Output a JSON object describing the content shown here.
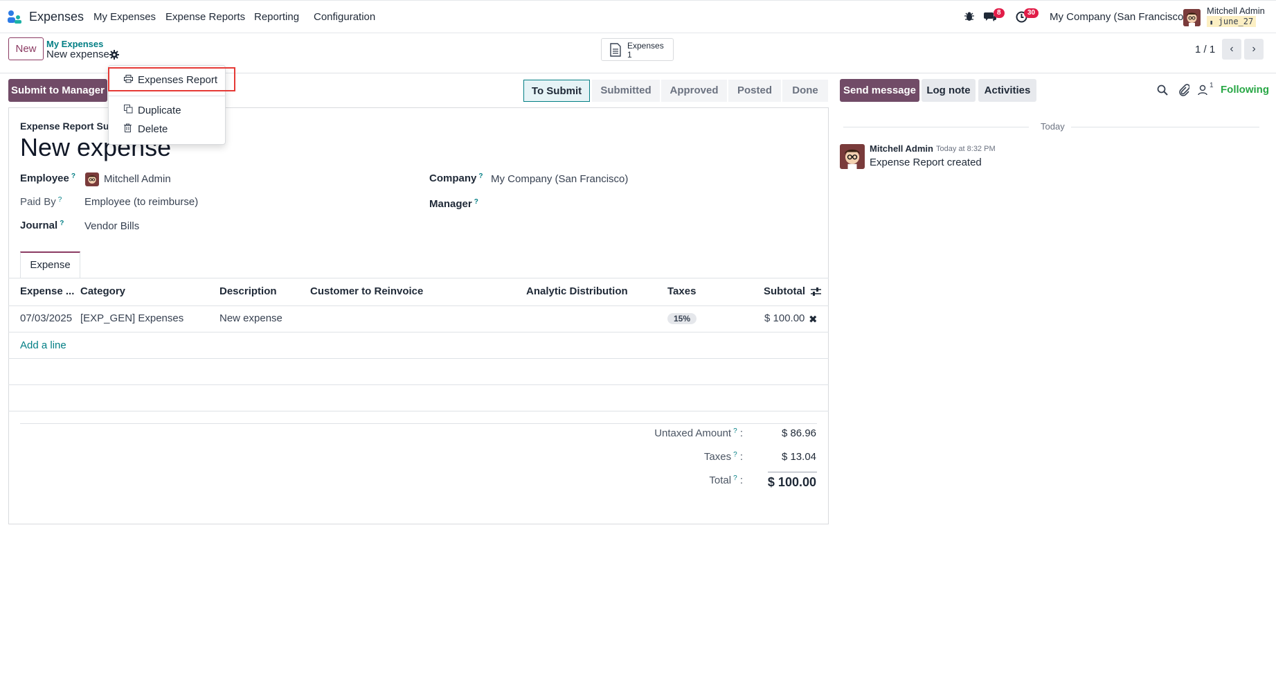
{
  "nav": {
    "app_name": "Expenses",
    "menu": [
      "My Expenses",
      "Expense Reports",
      "Reporting",
      "Configuration"
    ],
    "messages_badge": "8",
    "activities_badge": "30",
    "company": "My Company (San Francisco)",
    "user_name": "Mitchell Admin",
    "db_name": "june_27"
  },
  "control": {
    "new_label": "New",
    "breadcrumb_parent": "My Expenses",
    "breadcrumb_current": "New expense",
    "smart_button_label": "Expenses",
    "smart_button_count": "1",
    "pager": "1 / 1"
  },
  "dropdown": {
    "items": [
      "Expenses Report",
      "Duplicate",
      "Delete"
    ]
  },
  "statusbar": {
    "submit_label": "Submit to Manager",
    "stages": [
      "To Submit",
      "Submitted",
      "Approved",
      "Posted",
      "Done"
    ],
    "active_stage": "To Submit"
  },
  "chatter": {
    "send_message": "Send message",
    "log_note": "Log note",
    "activities": "Activities",
    "followers_count": "1",
    "following": "Following",
    "date_separator": "Today",
    "message_author": "Mitchell Admin",
    "message_time": "Today at 8:32 PM",
    "message_body": "Expense Report created"
  },
  "form": {
    "summary_label": "Expense Report Sum",
    "title": "New expense",
    "employee_label": "Employee",
    "employee_value": "Mitchell Admin",
    "paid_by_label": "Paid By",
    "paid_by_value": "Employee (to reimburse)",
    "journal_label": "Journal",
    "journal_value": "Vendor Bills",
    "company_label": "Company",
    "company_value": "My Company (San Francisco)",
    "manager_label": "Manager",
    "tab_label": "Expense"
  },
  "table": {
    "headers": [
      "Expense ...",
      "Category",
      "Description",
      "Customer to Reinvoice",
      "Analytic Distribution",
      "Taxes",
      "Subtotal"
    ],
    "rows": [
      {
        "date": "07/03/2025",
        "category": "[EXP_GEN] Expenses",
        "description": "New expense",
        "customer": "",
        "analytic": "",
        "taxes": "15%",
        "subtotal": "$ 100.00"
      }
    ],
    "add_line": "Add a line"
  },
  "totals": {
    "untaxed_label": "Untaxed Amount",
    "untaxed_value": "$ 86.96",
    "taxes_label": "Taxes",
    "taxes_value": "$ 13.04",
    "total_label": "Total",
    "total_value": "$ 100.00"
  },
  "colors": {
    "primary": "#714b67",
    "teal": "#017e84",
    "badge_red": "#e11d48",
    "highlight_box": "#e53935",
    "following_green": "#28a745"
  }
}
